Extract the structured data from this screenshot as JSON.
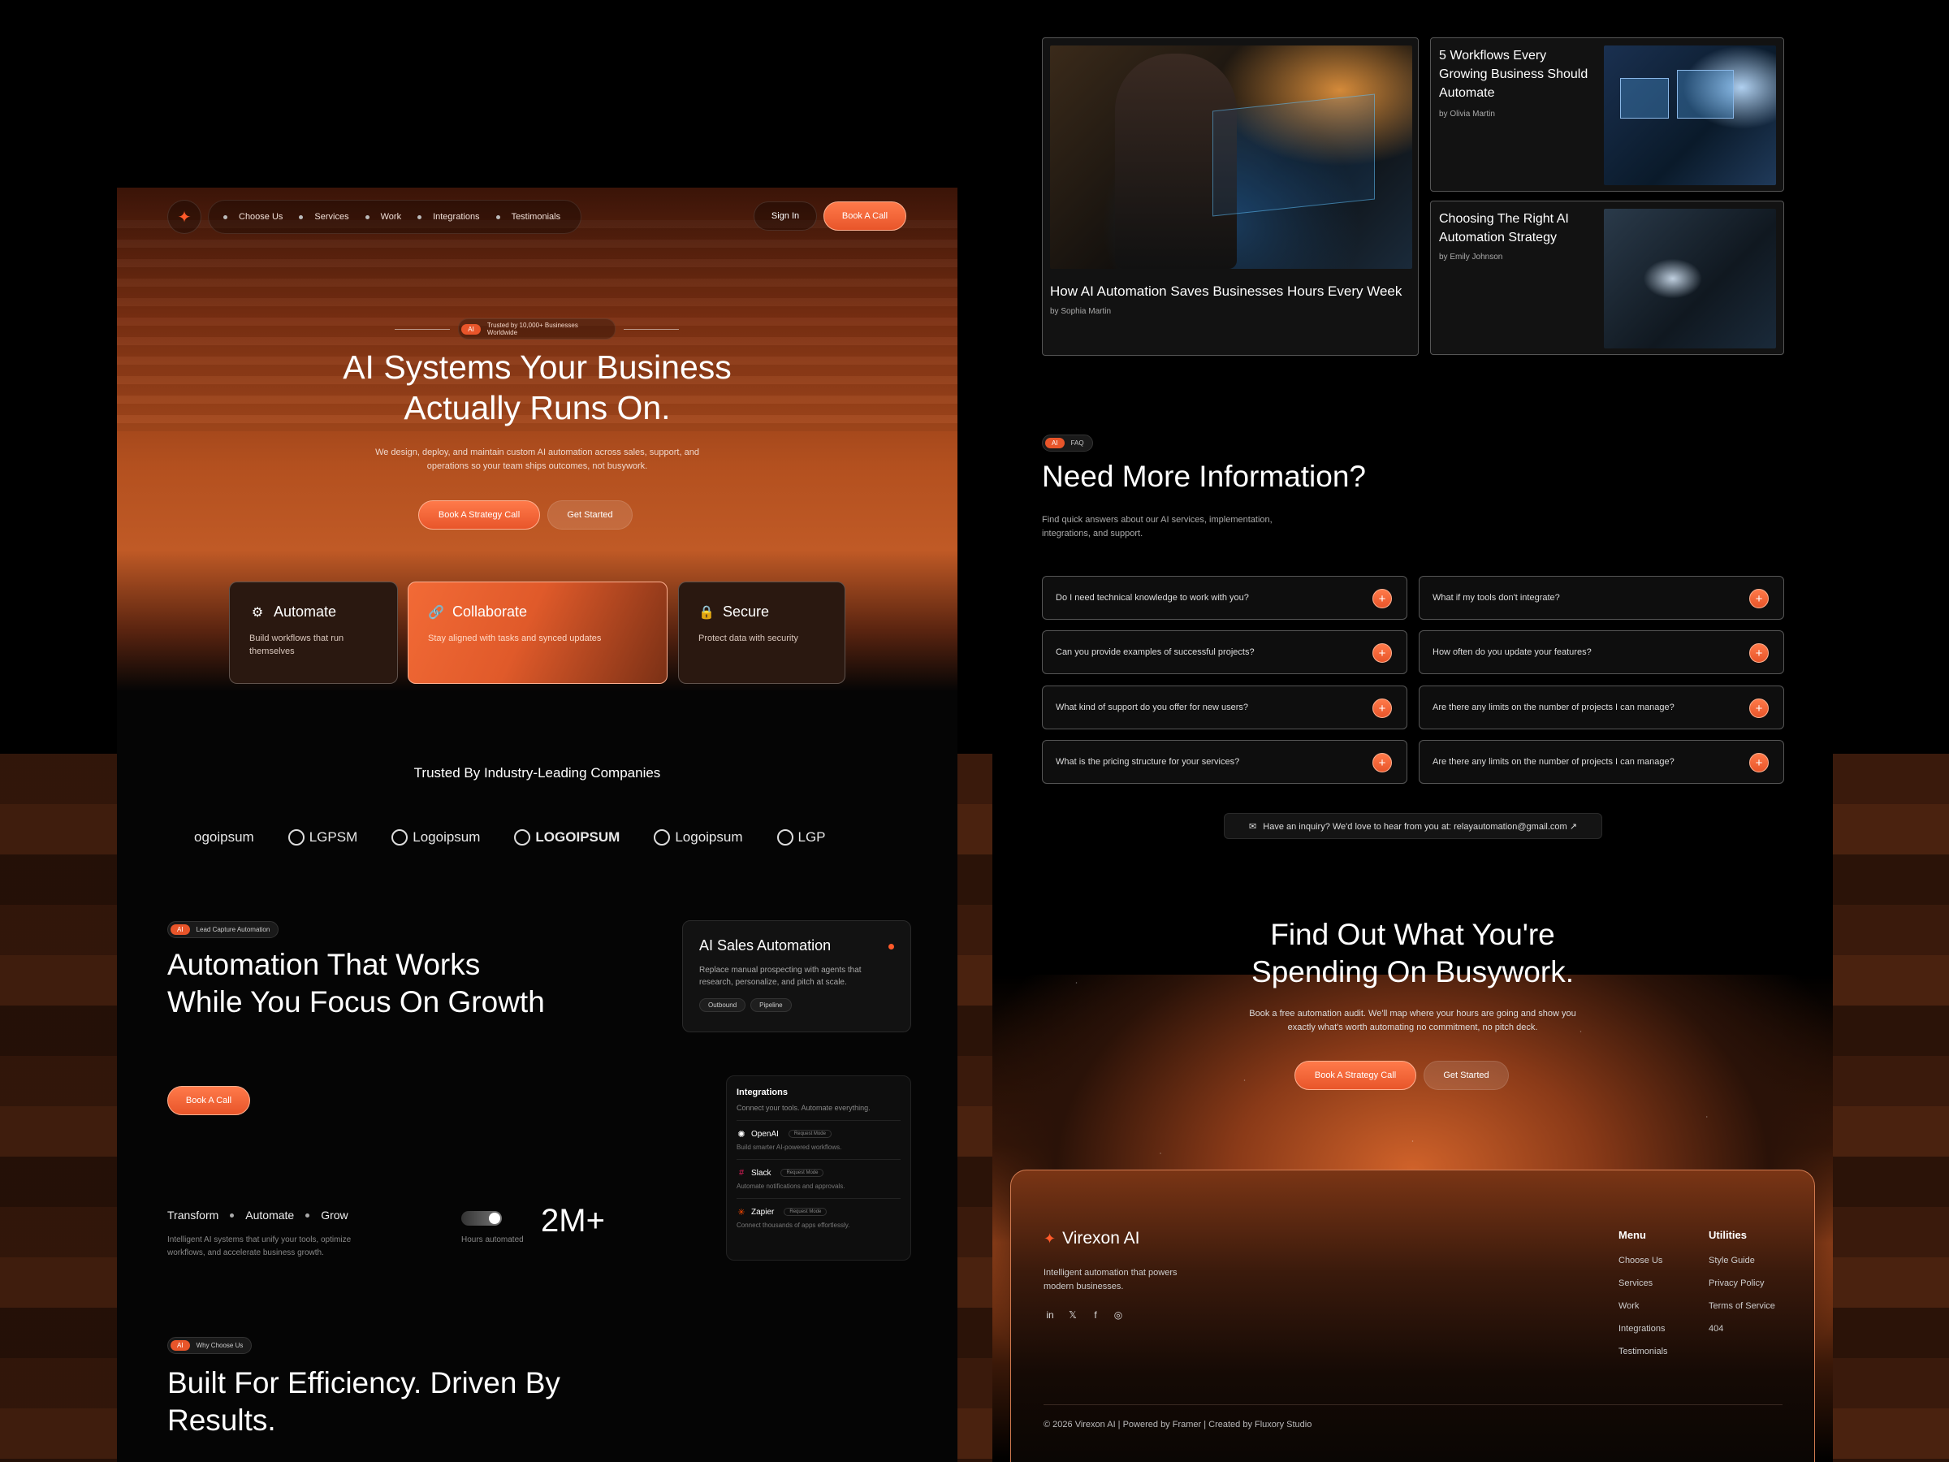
{
  "nav": {
    "items": [
      "Choose Us",
      "Services",
      "Work",
      "Integrations",
      "Testimonials"
    ],
    "sign_in": "Sign In",
    "book_call": "Book A Call"
  },
  "hero": {
    "badge_ai": "AI",
    "badge_text": "Trusted by 10,000+ Businesses Worldwide",
    "title_line1": "AI Systems Your Business",
    "title_line2": "Actually Runs On.",
    "subtitle": "We design, deploy, and maintain custom AI automation across sales, support, and operations so your team ships outcomes, not busywork.",
    "cta_primary": "Book A Strategy Call",
    "cta_secondary": "Get Started"
  },
  "features": [
    {
      "title": "Automate",
      "desc": "Build workflows that run themselves",
      "icon": "gear-icon"
    },
    {
      "title": "Collaborate",
      "desc": "Stay aligned with tasks and synced updates",
      "icon": "link-icon"
    },
    {
      "title": "Secure",
      "desc": "Protect data with security",
      "icon": "lock-icon"
    }
  ],
  "trusted": {
    "title": "Trusted By Industry-Leading Companies",
    "logos": [
      "ogoipsum",
      "LGPSM",
      "Logoipsum",
      "LOGOIPSUM",
      "Logoipsum",
      "LGP"
    ]
  },
  "automation": {
    "badge_ai": "AI",
    "badge_text": "Lead Capture Automation",
    "title": "Automation That Works While You Focus On Growth",
    "cta": "Book A Call"
  },
  "sales_card": {
    "title": "AI Sales Automation",
    "desc": "Replace manual prospecting with agents that research, personalize, and pitch at scale.",
    "tags": [
      "Outbound",
      "Pipeline"
    ]
  },
  "integrations": {
    "title": "Integrations",
    "subtitle": "Connect your tools. Automate everything.",
    "items": [
      {
        "name": "OpenAI",
        "req": "Request Mode",
        "desc": "Build smarter AI-powered workflows."
      },
      {
        "name": "Slack",
        "req": "Request Mode",
        "desc": "Automate notifications and approvals."
      },
      {
        "name": "Zapier",
        "req": "Request Mode",
        "desc": "Connect thousands of apps effortlessly."
      }
    ]
  },
  "stats": {
    "words": [
      "Transform",
      "Automate",
      "Grow"
    ],
    "desc": "Intelligent AI systems that unify your tools, optimize workflows, and accelerate business growth.",
    "hours_label": "Hours automated",
    "value": "2M+"
  },
  "why": {
    "badge_ai": "AI",
    "badge_text": "Why Choose Us",
    "title": "Built For Efficiency. Driven By Results."
  },
  "blog": {
    "main": {
      "title": "How AI Automation Saves Businesses Hours Every Week",
      "author": "by Sophia Martin"
    },
    "side1": {
      "title": "5 Workflows Every Growing Business Should Automate",
      "author": "by Olivia Martin"
    },
    "side2": {
      "title": "Choosing The Right AI Automation Strategy",
      "author": "by Emily Johnson"
    }
  },
  "faq": {
    "badge_ai": "AI",
    "badge_text": "FAQ",
    "title": "Need More Information?",
    "subtitle": "Find quick answers about our AI services, implementation, integrations, and support.",
    "questions_left": [
      "Do I need technical knowledge to work with you?",
      "Can you provide examples of successful projects?",
      "What kind of support do you offer for new users?",
      "What is the pricing structure for your services?"
    ],
    "questions_right": [
      "What if my tools don't integrate?",
      "How often do you update your features?",
      "Are there any limits on the number of projects I can manage?",
      "Are there any limits on the number of projects I can manage?"
    ],
    "inquiry": "Have an inquiry? We'd love to hear from you at: relayautomation@gmail.com ↗"
  },
  "cta": {
    "title_line1": "Find Out What You're",
    "title_line2": "Spending On Busywork.",
    "subtitle": "Book a free automation audit. We'll map where your hours are going and show you exactly what's worth automating no commitment, no pitch deck.",
    "primary": "Book A Strategy Call",
    "secondary": "Get Started"
  },
  "footer": {
    "brand": "Virexon AI",
    "desc": "Intelligent automation that powers modern businesses.",
    "menu_title": "Menu",
    "menu": [
      "Choose Us",
      "Services",
      "Work",
      "Integrations",
      "Testimonials"
    ],
    "utilities_title": "Utilities",
    "utilities": [
      "Style Guide",
      "Privacy Policy",
      "Terms of Service",
      "404"
    ],
    "copyright": "© 2026 Virexon AI | Powered by Framer | Created by Fluxory Studio"
  },
  "colors": {
    "accent": "#e8552a",
    "background": "#000000"
  }
}
